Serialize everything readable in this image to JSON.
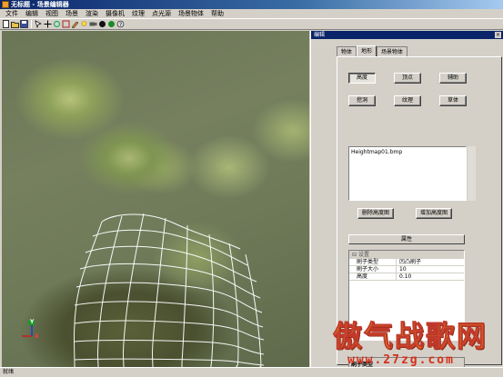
{
  "window": {
    "title": "无标题 - 场景编辑器"
  },
  "menu": [
    "文件",
    "编辑",
    "视图",
    "场景",
    "渲染",
    "摄像机",
    "纹理",
    "点光源",
    "场景物体",
    "帮助"
  ],
  "toolbar_icons": [
    "new-icon",
    "open-icon",
    "save-icon",
    "select-icon",
    "move-icon",
    "rotate-icon",
    "scale-icon",
    "brush-icon",
    "light-icon",
    "camera-icon",
    "render-icon",
    "sphere-icon",
    "help-icon"
  ],
  "viewport": {
    "axis_x": "X",
    "axis_y": "Y"
  },
  "panel": {
    "title": "编辑",
    "close": "×",
    "tabs": [
      "物体",
      "地形",
      "场景物体"
    ],
    "active_tab": 1,
    "buttons": {
      "height": "高度",
      "vertex": "顶点",
      "assist": "辅助",
      "dig": "挖洞",
      "texture": "纹理",
      "grass": "草体",
      "delete_heightmap": "删除高度图",
      "add_heightmap": "增加高度图"
    },
    "heightmap_list": [
      "Heightmap01.bmp"
    ],
    "properties_title": "属性",
    "prop_category": "设置",
    "props": [
      {
        "key": "刷子类型",
        "value": "凹凸刷子"
      },
      {
        "key": "刷子大小",
        "value": "10"
      },
      {
        "key": "高度",
        "value": "0.10"
      }
    ],
    "prop_desc": "刷子类型"
  },
  "status": {
    "text": "就绪"
  },
  "watermark": {
    "big": "傲气战歌网",
    "small": "www.27zg.com"
  }
}
